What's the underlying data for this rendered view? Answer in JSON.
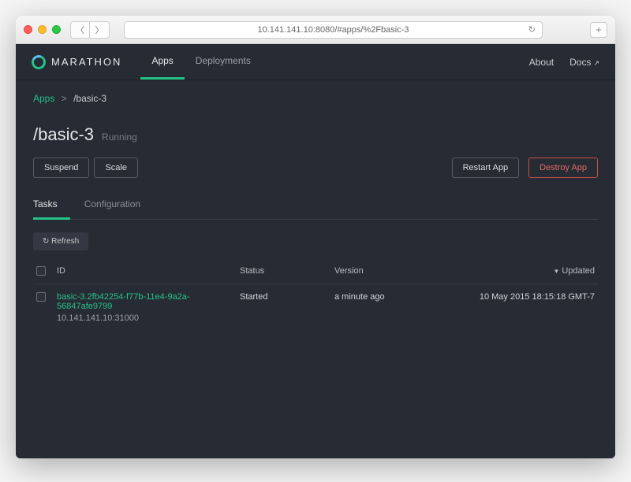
{
  "browser": {
    "url": "10.141.141.10:8080/#apps/%2Fbasic-3"
  },
  "logo": {
    "text": "MARATHON"
  },
  "nav": {
    "tabs": [
      {
        "label": "Apps",
        "active": true
      },
      {
        "label": "Deployments",
        "active": false
      }
    ],
    "right": {
      "about": "About",
      "docs": "Docs"
    }
  },
  "breadcrumb": {
    "root": "Apps",
    "sep": ">",
    "current": "/basic-3"
  },
  "appHeader": {
    "title": "/basic-3",
    "status": "Running"
  },
  "actions": {
    "suspend": "Suspend",
    "scale": "Scale",
    "restart": "Restart App",
    "destroy": "Destroy App"
  },
  "subtabs": [
    {
      "label": "Tasks",
      "active": true
    },
    {
      "label": "Configuration",
      "active": false
    }
  ],
  "toolbar": {
    "refresh": "Refresh"
  },
  "table": {
    "headers": {
      "id": "ID",
      "status": "Status",
      "version": "Version",
      "updated": "Updated"
    },
    "rows": [
      {
        "taskId": "basic-3.2fb42254-f77b-11e4-9a2a-56847afe9799",
        "endpoint": "10.141.141.10:31000",
        "status": "Started",
        "version": "a minute ago",
        "updated": "10 May 2015 18:15:18 GMT-7"
      }
    ]
  }
}
